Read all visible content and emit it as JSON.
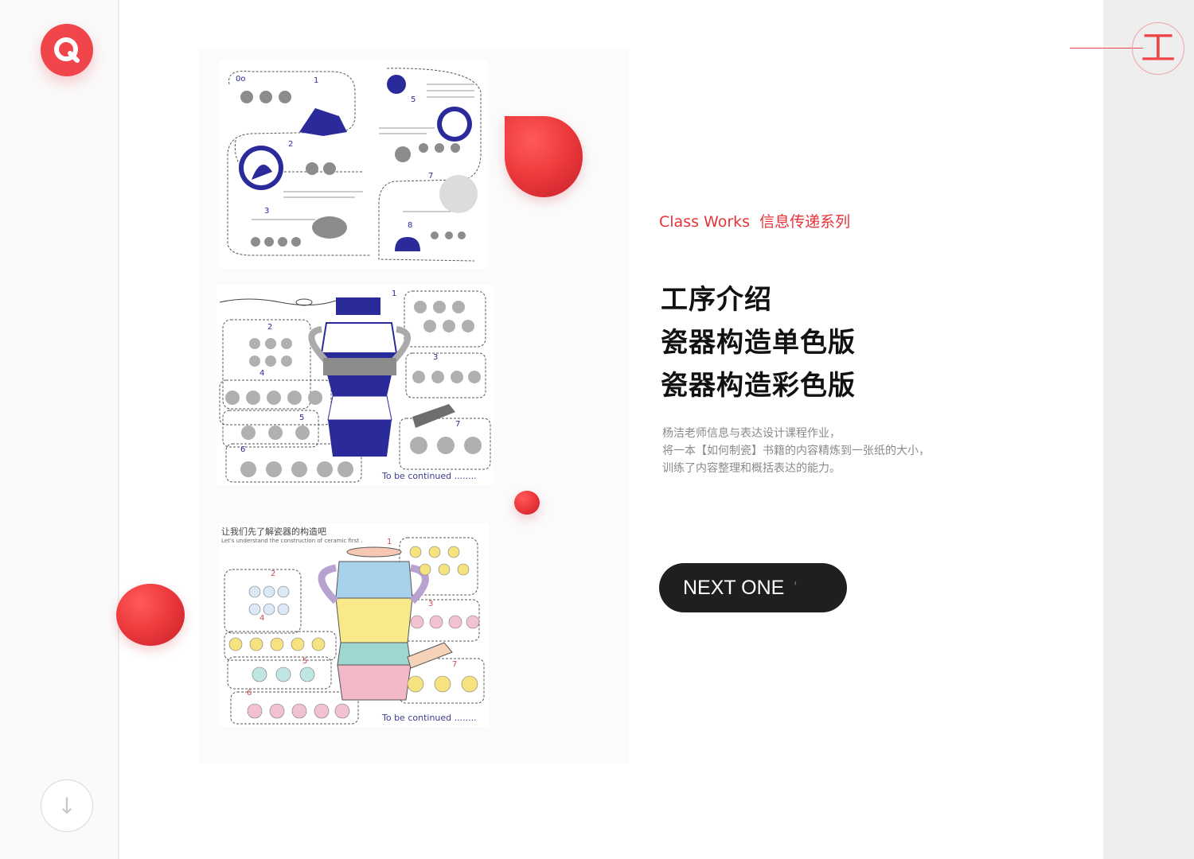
{
  "logo": {
    "glyph": "Q"
  },
  "section": {
    "badge_glyph": "工"
  },
  "scroll": {
    "glyph": "↓"
  },
  "eyebrow": {
    "en": "Class Works",
    "cn": "信息传递系列"
  },
  "titles": [
    "工序介绍",
    "瓷器构造单色版",
    "瓷器构造彩色版"
  ],
  "description": [
    "杨洁老师信息与表达设计课程作业，",
    "将一本【如何制瓷】书籍的内容精炼到一张纸的大小，",
    "训练了内容整理和概括表达的能力。"
  ],
  "next_button": {
    "label": "NEXT ONE",
    "trail": "'"
  },
  "posters": {
    "poster2_caption": "To be continued ........",
    "poster3_heading": "让我们先了解瓷器的构造吧",
    "poster3_subheading": "Let's understand the construction of ceramic first .",
    "poster3_caption": "To be continued ........"
  },
  "colors": {
    "accent": "#f0454a",
    "dark_button": "#1f1f1f",
    "poster_ink": "#2a2a9a"
  }
}
